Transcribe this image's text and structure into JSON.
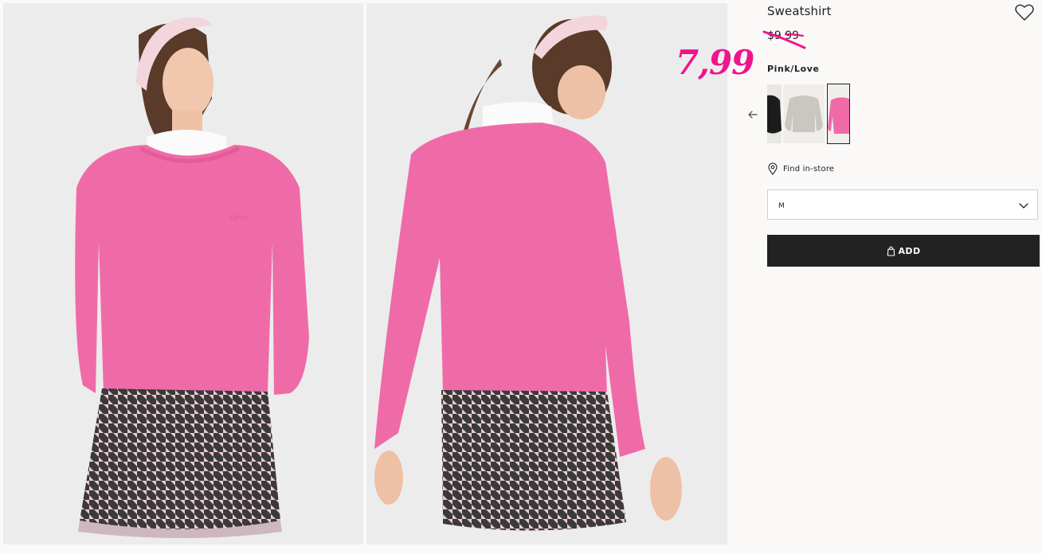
{
  "product": {
    "title": "Sweatshirt",
    "old_price": "$9.99",
    "sale_price": "7,99",
    "color_name": "Pink/Love",
    "chest_print": "Love"
  },
  "swatches": [
    {
      "name": "black",
      "color": "#1c1c1c"
    },
    {
      "name": "light-grey",
      "color": "#c9c7c0"
    },
    {
      "name": "pink",
      "color": "#ef6ba8",
      "selected": true
    }
  ],
  "actions": {
    "find_in_store": "Find in-store",
    "size_selected": "M",
    "add_label": "ADD"
  },
  "icons": {
    "favorite": "heart-icon",
    "previous": "arrow-left-icon",
    "store": "location-pin-icon",
    "dropdown": "chevron-down-icon",
    "bag": "shopping-bag-icon"
  },
  "colors": {
    "sale_accent": "#f0148c",
    "button_bg": "#222222",
    "sweatshirt_pink": "#ef6ba8",
    "page_bg": "#faf9f8"
  }
}
